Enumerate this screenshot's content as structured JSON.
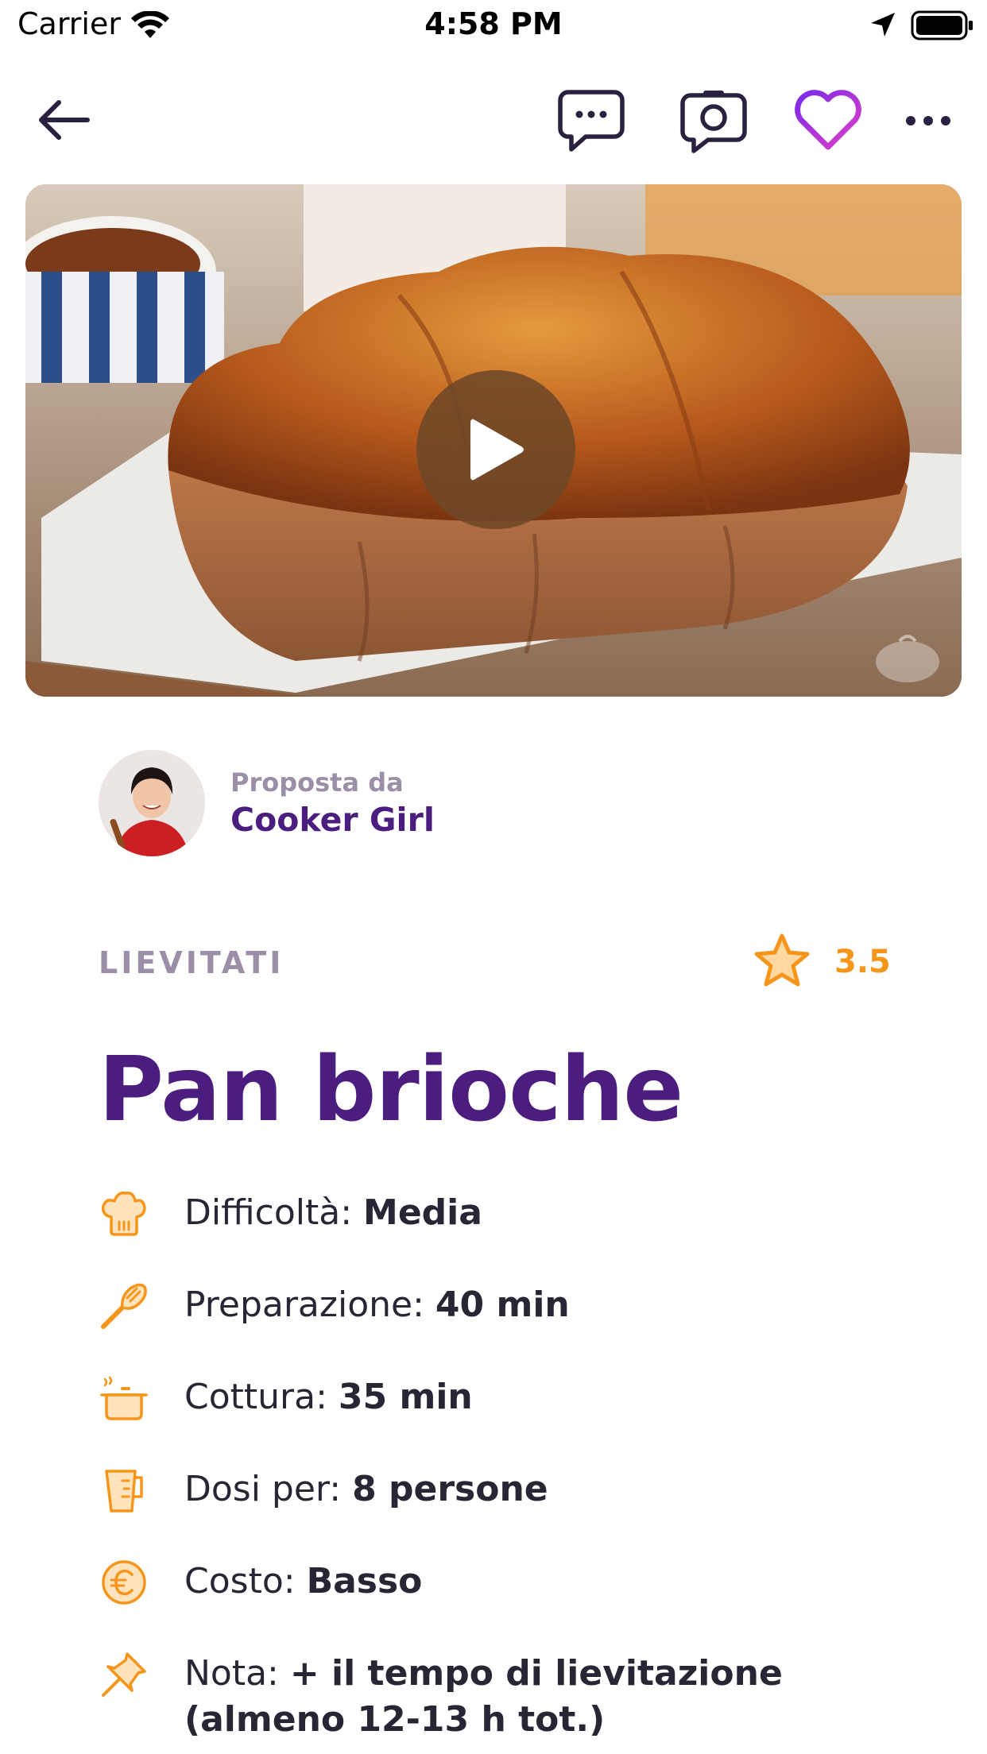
{
  "status_bar": {
    "carrier": "Carrier",
    "time": "4:58 PM"
  },
  "nav": {
    "icons": [
      "arrow-left-icon",
      "chat-bubble-icon",
      "camera-icon",
      "heart-icon",
      "ellipsis-icon"
    ]
  },
  "colors": {
    "brand_purple": "#4a1d7e",
    "accent_orange": "#f6951b",
    "muted": "#9a8fa6",
    "heart_gradient": [
      "#7a2be8",
      "#e040c8"
    ]
  },
  "author": {
    "label": "Proposta da",
    "name": "Cooker Girl"
  },
  "recipe": {
    "category": "LIEVITATI",
    "rating": "3.5",
    "title": "Pan brioche",
    "details": [
      {
        "icon": "chef-hat-icon",
        "label": "Difficoltà:",
        "value": "Media"
      },
      {
        "icon": "spatula-icon",
        "label": "Preparazione:",
        "value": "40 min"
      },
      {
        "icon": "cooking-pot-icon",
        "label": "Cottura:",
        "value": "35 min"
      },
      {
        "icon": "measuring-jug-icon",
        "label": "Dosi per:",
        "value": "8 persone"
      },
      {
        "icon": "euro-icon",
        "label": "Costo:",
        "value": "Basso"
      },
      {
        "icon": "pin-icon",
        "label": "Nota:",
        "value": "+ il tempo di lievitazione (almeno 12-13 h tot.)"
      }
    ]
  }
}
